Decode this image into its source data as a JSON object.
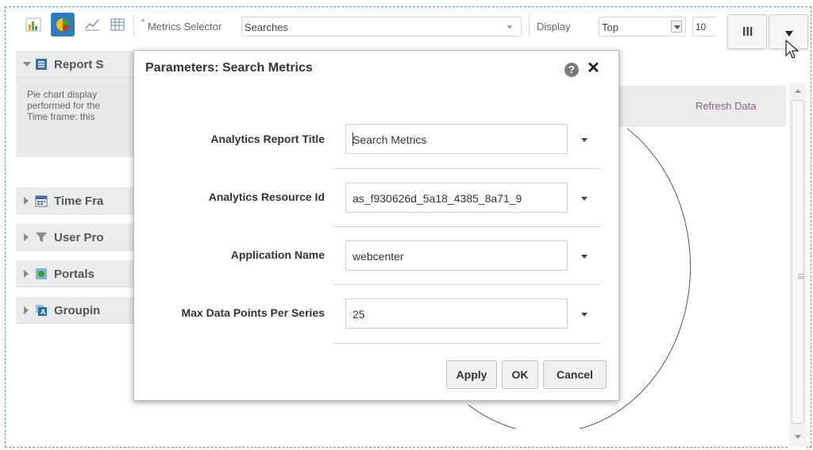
{
  "toolbar": {
    "metrics_required_mark": "*",
    "metrics_label": "Metrics Selector",
    "metrics_value": "Searches",
    "display_label": "Display",
    "display_value": "Top",
    "count_value": "10",
    "columns_button_label": "III"
  },
  "left_panel": {
    "report_header": "Report S",
    "description_lines": [
      "Pie chart display",
      "performed for the",
      "Time frame: this"
    ],
    "sections": [
      {
        "label": "Time Fra",
        "icon": "calendar-icon"
      },
      {
        "label": "User Pro",
        "icon": "funnel-icon"
      },
      {
        "label": "Portals",
        "icon": "portal-icon"
      },
      {
        "label": "Groupin",
        "icon": "grouping-icon"
      }
    ]
  },
  "right_panel": {
    "refresh_link": "Refresh Data"
  },
  "dialog": {
    "title": "Parameters: Search Metrics",
    "help_glyph": "?",
    "close_glyph": "✕",
    "fields": [
      {
        "label": "Analytics Report Title",
        "value": "Search Metrics"
      },
      {
        "label": "Analytics Resource Id",
        "value": "as_f930626d_5a18_4385_8a71_9"
      },
      {
        "label": "Application Name",
        "value": "webcenter"
      },
      {
        "label": "Max Data Points Per Series",
        "value": "25"
      }
    ],
    "buttons": {
      "apply": "Apply",
      "ok": "OK",
      "cancel": "Cancel"
    }
  },
  "colors": {
    "frame_border": "#6b8fb5",
    "link": "#8e5a90",
    "panel_bg": "#ececec"
  }
}
